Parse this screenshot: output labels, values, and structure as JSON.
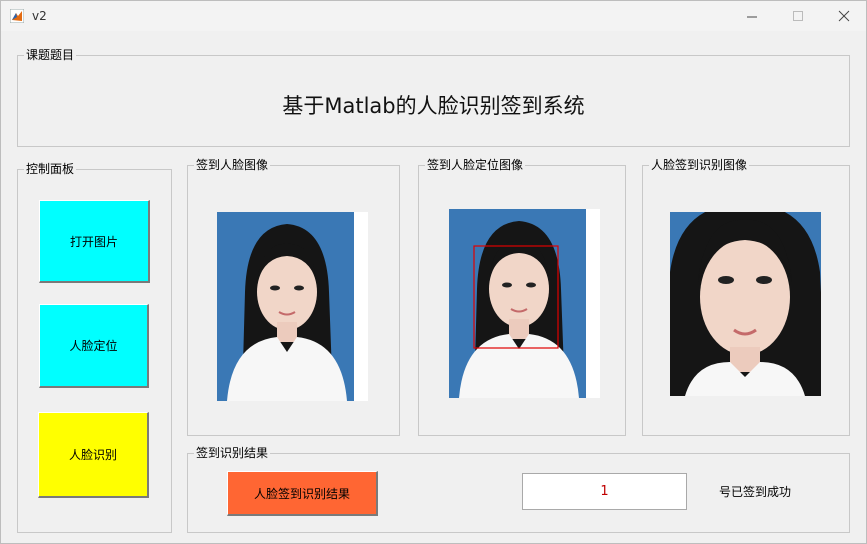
{
  "window": {
    "title": "v2"
  },
  "topic_panel": {
    "label": "课题题目",
    "title": "基于Matlab的人脸识别签到系统"
  },
  "control_panel": {
    "label": "控制面板",
    "open_button": {
      "label": "打开图片",
      "color": "#00FFFF"
    },
    "locate_button": {
      "label": "人脸定位",
      "color": "#00FFFF"
    },
    "recognize_button": {
      "label": "人脸识别",
      "color": "#FFFF00"
    }
  },
  "image_panels": [
    {
      "label": "签到人脸图像"
    },
    {
      "label": "签到人脸定位图像"
    },
    {
      "label": "人脸签到识别图像"
    }
  ],
  "result_panel": {
    "label": "签到识别结果",
    "result_button": {
      "label": "人脸签到识别结果",
      "color": "#FF6633"
    },
    "result_value": "1",
    "success_text": "号已签到成功"
  },
  "colors": {
    "photo_background": "#3a78b5",
    "face_box": "#e00000"
  }
}
